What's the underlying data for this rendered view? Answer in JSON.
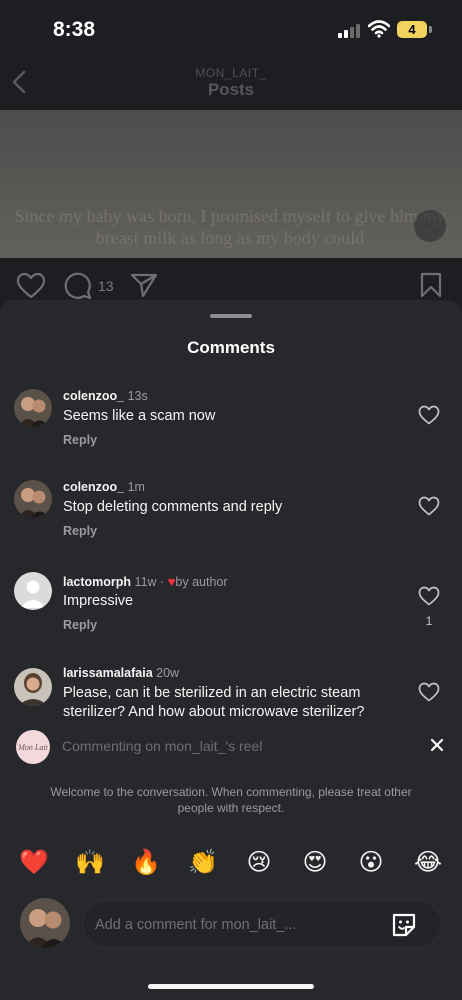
{
  "status_bar": {
    "time": "8:38",
    "battery": "4"
  },
  "header": {
    "username": "MON_LAIT_",
    "title": "Posts"
  },
  "video": {
    "caption": "Since my baby was born, I promised myself to give him my breast milk as long as my body could"
  },
  "actions": {
    "comment_count": "13"
  },
  "sheet": {
    "title": "Comments",
    "reply_label": "Reply",
    "comments": [
      {
        "username": "colenzoo_",
        "time": "13s",
        "text": "Seems like a scam now"
      },
      {
        "username": "colenzoo_",
        "time": "1m",
        "text": "Stop deleting comments and reply"
      },
      {
        "username": "lactomorph",
        "time": "11w",
        "separator": "·",
        "liked_by": "by author",
        "text": "Impressive",
        "likes": "1"
      },
      {
        "username": "larissamalafaia",
        "time": "20w",
        "text": "Please, can it be sterilized  in an electric steam sterilizer? And how about microwave sterilizer?"
      }
    ],
    "commenting_on": "Commenting on mon_lait_'s reel",
    "brand_avatar_text": "Mon Lait",
    "welcome": "Welcome to the conversation. When commenting, please treat other people with respect.",
    "emojis": [
      "❤️",
      "🙌",
      "🔥",
      "👏",
      "😢",
      "😍",
      "😮",
      "😂"
    ],
    "composer_placeholder": "Add a comment for mon_lait_..."
  },
  "colors": {
    "background": "#1c1d21",
    "sheet": "#27282c",
    "like_red": "#ff3040"
  },
  "icons": [
    "back-chevron-icon",
    "mute-icon",
    "heart-icon",
    "comment-icon",
    "share-icon",
    "bookmark-icon",
    "close-icon",
    "sticker-icon"
  ]
}
